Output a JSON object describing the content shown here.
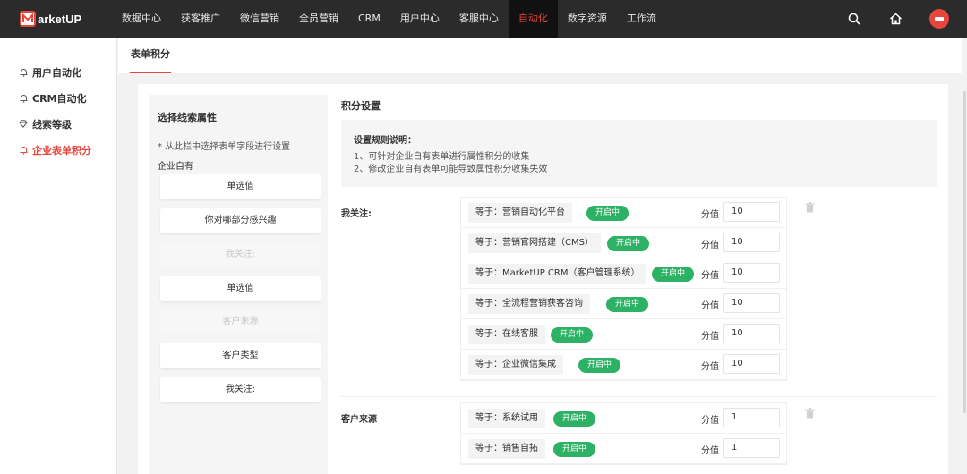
{
  "app": {
    "logo_text": "arketUP",
    "logo_letter": "M"
  },
  "nav": {
    "items": [
      {
        "label": "数据中心",
        "active": false
      },
      {
        "label": "获客推广",
        "active": false
      },
      {
        "label": "微信营销",
        "active": false
      },
      {
        "label": "全员营销",
        "active": false
      },
      {
        "label": "CRM",
        "active": false
      },
      {
        "label": "用户中心",
        "active": false
      },
      {
        "label": "客服中心",
        "active": false
      },
      {
        "label": "自动化",
        "active": true
      },
      {
        "label": "数字资源",
        "active": false
      },
      {
        "label": "工作流",
        "active": false
      }
    ]
  },
  "sidebar": {
    "items": [
      {
        "label": "用户自动化",
        "icon": "bell-icon",
        "active": false
      },
      {
        "label": "CRM自动化",
        "icon": "bell-icon",
        "active": false
      },
      {
        "label": "线索等级",
        "icon": "diamond-icon",
        "active": false
      },
      {
        "label": "企业表单积分",
        "icon": "bell-icon",
        "active": true
      }
    ]
  },
  "tab": {
    "label": "表单积分"
  },
  "attributes": {
    "title": "选择线索属性",
    "hint": "* 从此栏中选择表单字段进行设置",
    "group": "企业自有",
    "items": [
      {
        "label": "单选值",
        "disabled": false
      },
      {
        "label": "你对哪部分感兴趣",
        "disabled": false
      },
      {
        "label": "我关注:",
        "disabled": true
      },
      {
        "label": "单选值",
        "disabled": false
      },
      {
        "label": "客户来源",
        "disabled": true
      },
      {
        "label": "客户类型",
        "disabled": false
      },
      {
        "label": "我关注:",
        "disabled": false
      }
    ]
  },
  "settings": {
    "title": "积分设置",
    "rules_title": "设置规则说明：",
    "rules": [
      "1、可针对企业自有表单进行属性积分的收集",
      "2、修改企业自有表单可能导致属性积分收集失效"
    ],
    "score_label": "分值",
    "groups": [
      {
        "label": "我关注:",
        "rows": [
          {
            "cond": "等于：营销自动化平台",
            "status": "开启中",
            "score": "10"
          },
          {
            "cond": "等于：营销官网搭建（CMS）",
            "status": "开启中",
            "score": "10"
          },
          {
            "cond": "等于：MarketUP CRM（客户管理系统）",
            "status": "开启中",
            "score": "10"
          },
          {
            "cond": "等于：全流程营销获客咨询",
            "status": "开启中",
            "score": "10"
          },
          {
            "cond": "等于：在线客服",
            "status": "开启中",
            "score": "10"
          },
          {
            "cond": "等于：企业微信集成",
            "status": "开启中",
            "score": "10"
          }
        ]
      },
      {
        "label": "客户来源",
        "rows": [
          {
            "cond": "等于：系统试用",
            "status": "开启中",
            "score": "1"
          },
          {
            "cond": "等于：销售自拓",
            "status": "开启中",
            "score": "1"
          }
        ]
      }
    ]
  },
  "colors": {
    "brand": "#e8453c",
    "active_green": "#2db164",
    "topbar": "#2b2b2b"
  }
}
